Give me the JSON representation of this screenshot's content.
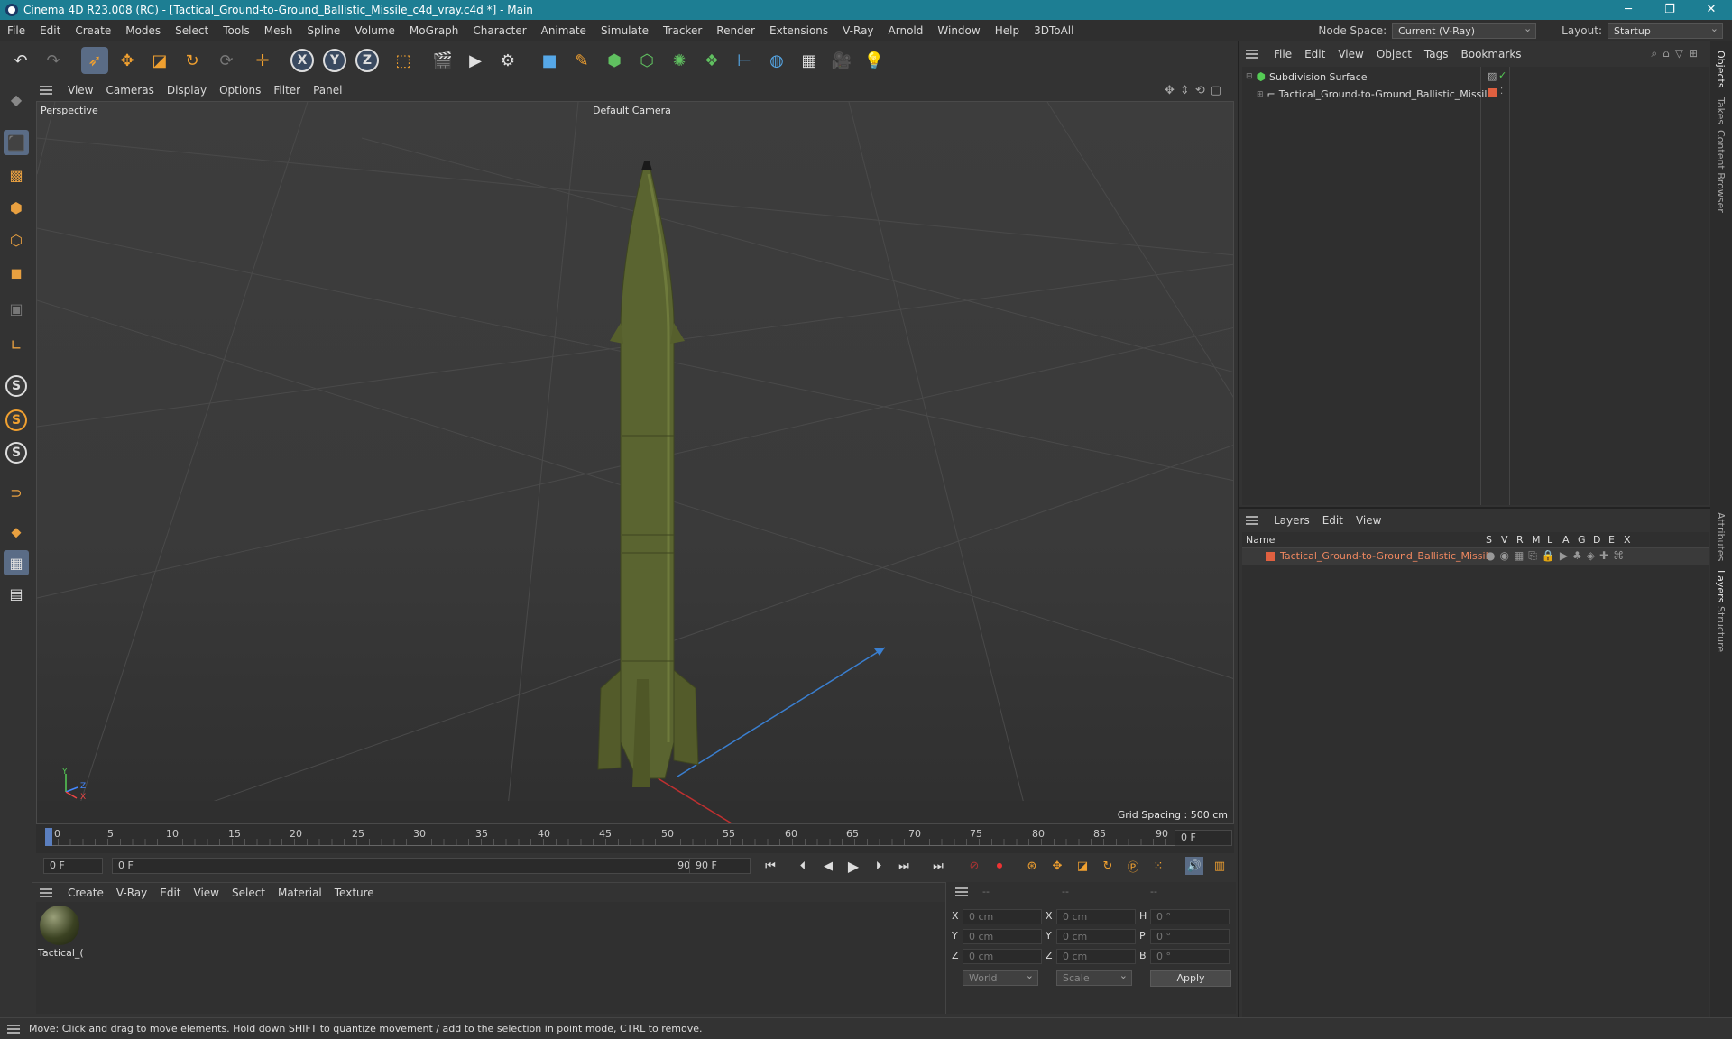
{
  "window": {
    "title": "Cinema 4D R23.008 (RC) - [Tactical_Ground-to-Ground_Ballistic_Missile_c4d_vray.c4d *] - Main",
    "minimize": "─",
    "maximize": "❐",
    "close": "✕"
  },
  "menubar": {
    "items": [
      "File",
      "Edit",
      "Create",
      "Modes",
      "Select",
      "Tools",
      "Mesh",
      "Spline",
      "Volume",
      "MoGraph",
      "Character",
      "Animate",
      "Simulate",
      "Tracker",
      "Render",
      "Extensions",
      "V-Ray",
      "Arnold",
      "Window",
      "Help",
      "3DToAll"
    ],
    "node_space_label": "Node Space:",
    "node_space_value": "Current (V-Ray)",
    "layout_label": "Layout:",
    "layout_value": "Startup"
  },
  "viewport": {
    "menu": [
      "View",
      "Cameras",
      "Display",
      "Options",
      "Filter",
      "Panel"
    ],
    "projection": "Perspective",
    "camera": "Default Camera",
    "grid_spacing": "Grid Spacing : 500 cm",
    "axis_y": "Y",
    "axis_z": "Z",
    "axis_x": "X"
  },
  "timeline": {
    "ticks": [
      "0",
      "5",
      "10",
      "15",
      "20",
      "25",
      "30",
      "35",
      "40",
      "45",
      "50",
      "55",
      "60",
      "65",
      "70",
      "75",
      "80",
      "85",
      "90"
    ],
    "current_frame": "0 F",
    "start_field": "0 F",
    "range_start": "0 F",
    "range_end": "90 F",
    "end_field": "90 F"
  },
  "material_manager": {
    "menu": [
      "Create",
      "V-Ray",
      "Edit",
      "View",
      "Select",
      "Material",
      "Texture"
    ],
    "material_name": "Tactical_("
  },
  "coordinates": {
    "headers": [
      "--",
      "--",
      "--"
    ],
    "rows": [
      {
        "l1": "X",
        "v1": "0 cm",
        "l2": "X",
        "v2": "0 cm",
        "l3": "H",
        "v3": "0 °"
      },
      {
        "l1": "Y",
        "v1": "0 cm",
        "l2": "Y",
        "v2": "0 cm",
        "l3": "P",
        "v3": "0 °"
      },
      {
        "l1": "Z",
        "v1": "0 cm",
        "l2": "Z",
        "v2": "0 cm",
        "l3": "B",
        "v3": "0 °"
      }
    ],
    "mode_world": "World",
    "mode_scale": "Scale",
    "apply": "Apply"
  },
  "object_manager": {
    "menu": [
      "File",
      "Edit",
      "View",
      "Object",
      "Tags",
      "Bookmarks"
    ],
    "objects": [
      {
        "name": "Subdivision Surface"
      },
      {
        "name": "Tactical_Ground-to-Ground_Ballistic_Missile"
      }
    ]
  },
  "layers": {
    "menu": [
      "Layers",
      "Edit",
      "View"
    ],
    "columns": [
      "Name",
      "S",
      "V",
      "R",
      "M",
      "L",
      "A",
      "G",
      "D",
      "E",
      "X"
    ],
    "rows": [
      {
        "name": "Tactical_Ground-to-Ground_Ballistic_Missile",
        "color": "#e06040"
      }
    ]
  },
  "right_tabs": [
    "Objects",
    "Takes",
    "Content Browser",
    "Attributes",
    "Layers",
    "Structure"
  ],
  "status": "Move: Click and drag to move elements. Hold down SHIFT to quantize movement / add to the selection in point mode, CTRL to remove.",
  "colors": {
    "titlebar": "#1d7e93",
    "selected_tool": "#5a6c86",
    "accent_orange": "#f0a030",
    "missile": "#5a6430"
  }
}
